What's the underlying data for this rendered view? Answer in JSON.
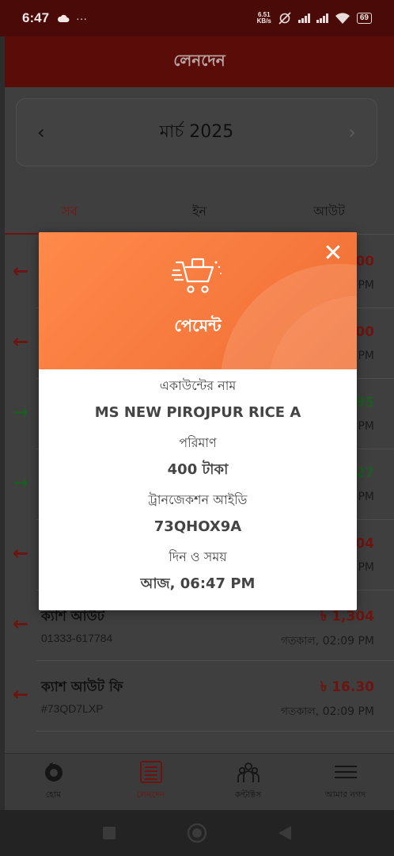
{
  "status_bar": {
    "time": "6:47",
    "left_icons": [
      "cloud-icon",
      "more-dots-icon"
    ],
    "net_speed_value": "6.51",
    "net_speed_unit": "KB/s",
    "battery": "69"
  },
  "header": {
    "title": "লেনদেন"
  },
  "month_selector": {
    "label": "মার্চ 2025",
    "prev": "‹",
    "next": "›"
  },
  "tabs": [
    {
      "label": "সব",
      "active": true
    },
    {
      "label": "ইন",
      "active": false
    },
    {
      "label": "আউট",
      "active": false
    }
  ],
  "transactions": [
    {
      "direction": "out",
      "name": "",
      "sub": "",
      "amount": ".00",
      "time": "PM"
    },
    {
      "direction": "out",
      "name": "",
      "sub": "",
      "amount": ".00",
      "time": "PM"
    },
    {
      "direction": "in",
      "name": "",
      "sub": "",
      "amount": ".95",
      "time": "PM"
    },
    {
      "direction": "in",
      "name": "",
      "sub": "",
      "amount": ".27",
      "time": "PM"
    },
    {
      "direction": "out",
      "name": "",
      "sub": "",
      "amount": ".04",
      "time": "PM"
    },
    {
      "direction": "out",
      "name": "ক্যাশ আউট",
      "sub": "01333-617784",
      "amount": "৳ 1,304",
      "time": "গতকাল, 02:09 PM"
    },
    {
      "direction": "out",
      "name": "ক্যাশ আউট ফি",
      "sub": "#73QD7LXP",
      "amount": "৳ 16.30",
      "time": "গতকাল, 02:09 PM"
    }
  ],
  "bottom_nav": [
    {
      "label": "হোম",
      "icon": "home-logo-icon",
      "active": false
    },
    {
      "label": "লেনদেন",
      "icon": "receipt-list-icon",
      "active": true
    },
    {
      "label": "কন্টাক্টস",
      "icon": "contacts-group-icon",
      "active": false
    },
    {
      "label": "আমার নগদ",
      "icon": "hamburger-menu-icon",
      "active": false
    }
  ],
  "modal": {
    "title": "পেমেন্ট",
    "icon": "shopping-cart-icon",
    "close": "✕",
    "account_label": "একাউন্টের নাম",
    "account_value": "MS NEW PIROJPUR RICE A",
    "amount_label": "পরিমাণ",
    "amount_value": "400 টাকা",
    "txid_label": "ট্রানজেকশন আইডি",
    "txid_value": "73QHOX9A",
    "datetime_label": "দিন ও সময়",
    "datetime_value": "আজ, 06:47 PM"
  },
  "colors": {
    "modal_header": "#f77a3e",
    "out": "#6e1410",
    "in": "#1e5a24",
    "header_bg": "#5a0c09"
  }
}
